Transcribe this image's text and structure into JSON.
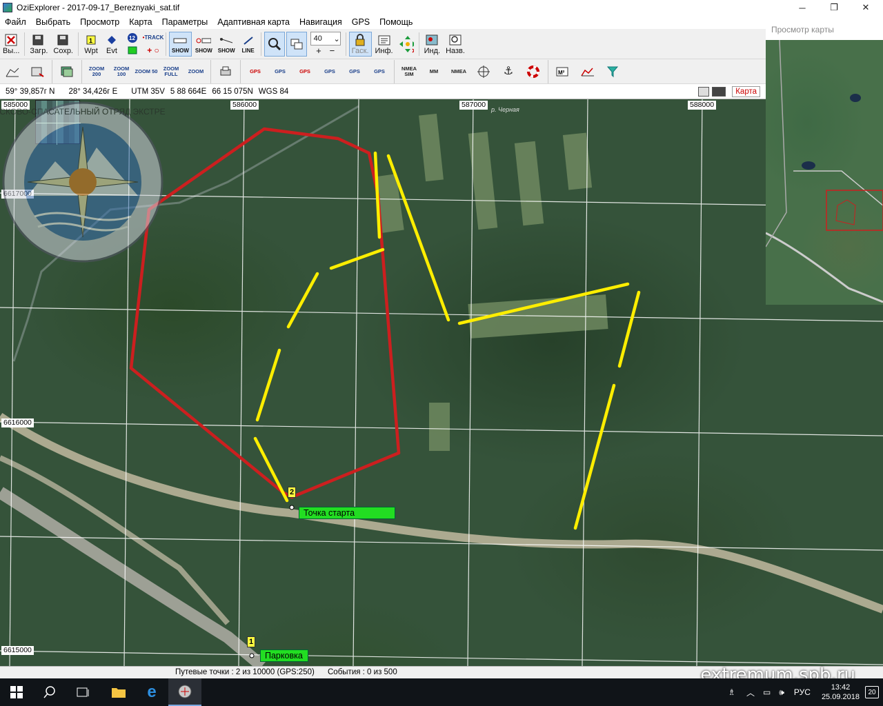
{
  "window": {
    "title": "OziExplorer - 2017-09-17_Bereznyaki_sat.tif",
    "minimize": "─",
    "restore": "❐",
    "close": "✕"
  },
  "menu": [
    "Файл",
    "Выбрать",
    "Просмотр",
    "Карта",
    "Параметры",
    "Адаптивная карта",
    "Навигация",
    "GPS",
    "Помощь"
  ],
  "toolbar1": {
    "exit_label": "Вы...",
    "load_label": "Загр.",
    "save_label": "Сохр.",
    "wpt_label": "Wpt",
    "evt_label": "Evt",
    "track_label": "TRACK",
    "show_label": "SHOW",
    "line_label": "LINE",
    "zoom_value": "40",
    "lock_label": "Гаск.",
    "info_label": "Инф.",
    "ind_label": "Инд.",
    "name_label": "Назв."
  },
  "toolbar2": {
    "zoom200": "ZOOM 200",
    "zoom100": "ZOOM 100",
    "zoom50": "ZOOM 50",
    "zoomfull": "ZOOM FULL",
    "zoom": "ZOOM",
    "gps1": "GPS",
    "gps2": "GPS",
    "gps3": "GPS",
    "gps4": "GPS",
    "gps5": "GPS",
    "gps6": "GPS",
    "nmea_sim": "NMEA SIM",
    "mm": "MM",
    "nmea": "NMEA"
  },
  "coords": {
    "lat": "59° 39,857г N",
    "lon": "28° 34,426г E",
    "utm": "UTM  35V",
    "easting": "5 88 664E",
    "northing": "66 15 075N",
    "datum": "WGS 84",
    "karta_tab": "Карта"
  },
  "grid_labels": {
    "x1": "585000",
    "x2": "586000",
    "x3": "587000",
    "x4": "588000",
    "y1": "6617000",
    "y2": "6616000",
    "y3": "6615000",
    "river": "р. Черная"
  },
  "waypoints": [
    {
      "num": "1",
      "label": "Парковка"
    },
    {
      "num": "2",
      "label": "Точка старта"
    }
  ],
  "overview": {
    "title": "Просмотр карты"
  },
  "status": {
    "waypoints": "Путевые точки : 2 из 10000  (GPS:250)",
    "events": "События : 0 из 500"
  },
  "watermark": "extremum.spb.ru",
  "emblem_text": "ПОИСКОВО-СПАСАТЕЛЬНЫЙ ОТРЯД ЭКСТРЕМУМ",
  "taskbar": {
    "lang": "РУС",
    "time": "13:42",
    "date": "25.09.2018",
    "notifications": "20"
  },
  "colors": {
    "route_red": "#cc1f1f",
    "search_yellow": "#ffee00",
    "waypoint_green": "#22dd22"
  }
}
